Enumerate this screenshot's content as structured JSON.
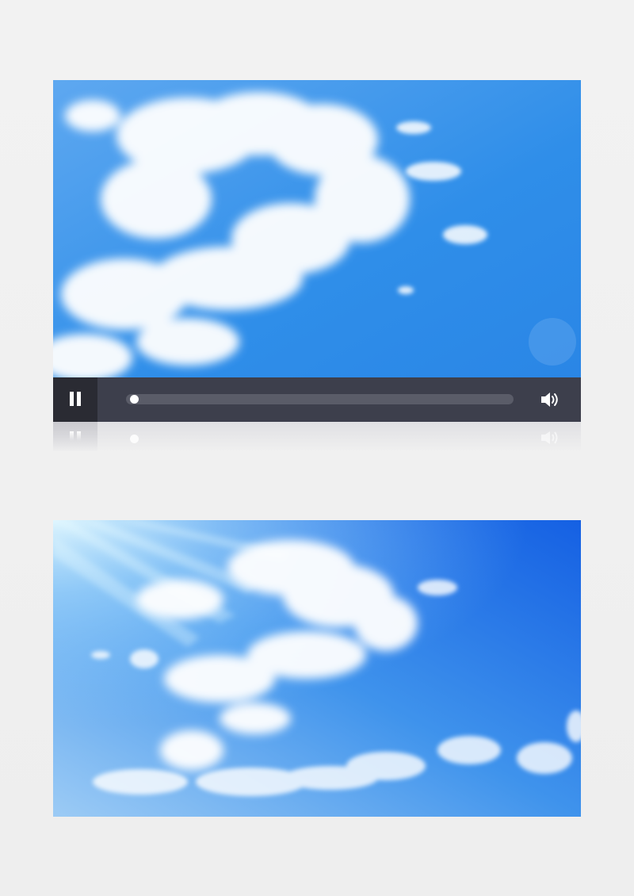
{
  "players": [
    {
      "state": "playing",
      "controls": {
        "pause_icon": "pause-icon",
        "volume_icon": "speaker-volume-icon",
        "progress": 0.02
      },
      "colors": {
        "bar": "#3d3f4c",
        "button": "#2a2b33",
        "track": "#5a5c68",
        "sky_top": "#2f8fe9",
        "sky_bottom": "#5aaaf0"
      }
    },
    {
      "state": "static-frame",
      "colors": {
        "sky_top": "#1d6fe6",
        "sky_bottom": "#8cc4f4",
        "sunlight": "#e8fbff"
      }
    }
  ],
  "background": "#efefef"
}
